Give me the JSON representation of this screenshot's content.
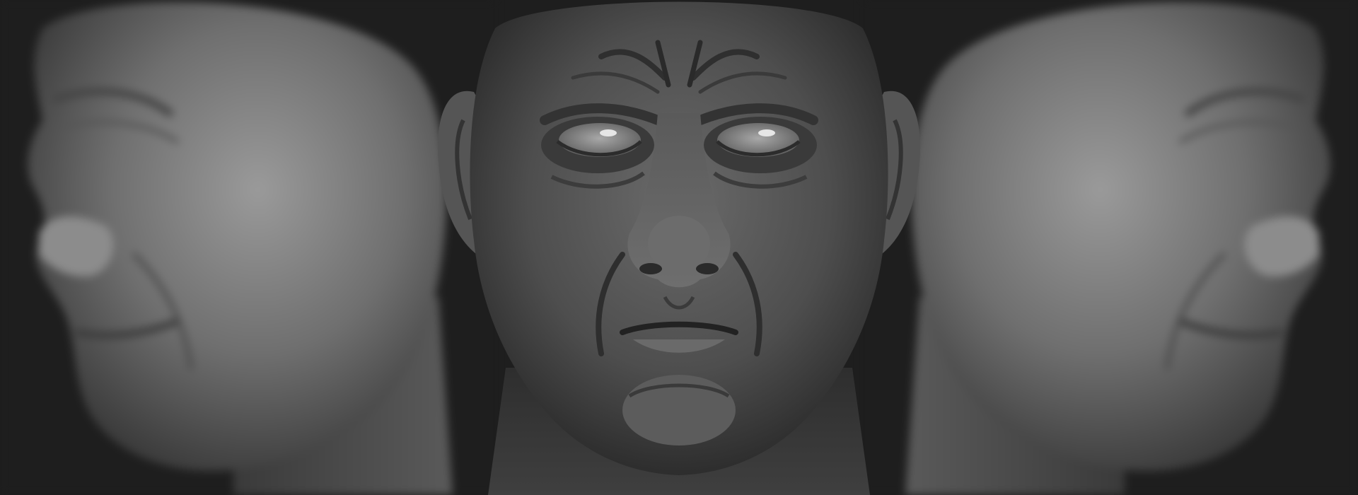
{
  "scene": {
    "background_color": "#1e1e1e",
    "clay_color": "#7a7a7a",
    "views": [
      {
        "view": "left-profile",
        "focus": "blurred"
      },
      {
        "view": "front",
        "focus": "sharp"
      },
      {
        "view": "right-profile",
        "focus": "blurred"
      }
    ]
  }
}
